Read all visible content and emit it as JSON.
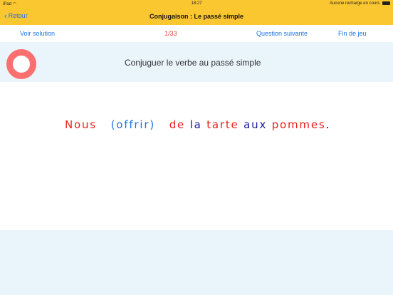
{
  "status_bar": {
    "device": "iPad",
    "time": "18:27",
    "charging": "Aucune recharge en cours"
  },
  "nav": {
    "back_label": "Retour",
    "title": "Conjugaison : Le passé simple"
  },
  "toolbar": {
    "solution_label": "Voir solution",
    "counter": "1/33",
    "next_label": "Question suivante",
    "end_label": "Fin de jeu"
  },
  "instruction": "Conjuguer le verbe au passé simple",
  "sentence": {
    "subject": "Nous",
    "verb": "(offrir)",
    "rest_parts": [
      "de",
      "la",
      "tarte",
      "aux",
      "pommes"
    ],
    "punctuation": "."
  },
  "colors": {
    "accent": "#1a73e8",
    "bar": "#fbc731",
    "ring": "#fb6f6f",
    "subject": "#e8201c"
  },
  "icons": {
    "back": "chevron-left-icon",
    "wifi": "wifi-icon",
    "battery": "battery-icon",
    "ring": "ring-icon"
  }
}
